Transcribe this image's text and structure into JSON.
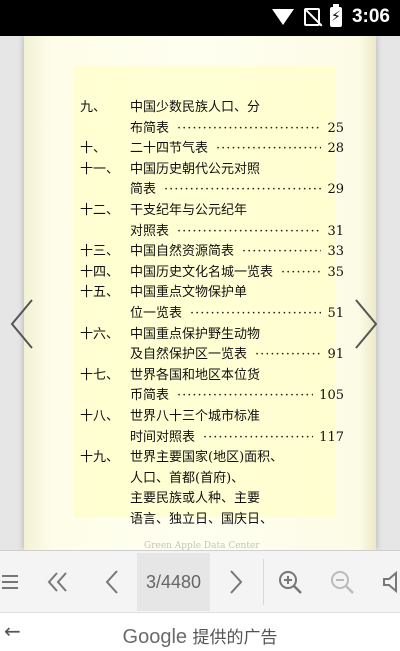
{
  "status_bar": {
    "time": "3:06"
  },
  "toc": [
    {
      "num": "九、",
      "title": "中国少数民族人口、分",
      "page": ""
    },
    {
      "num": "",
      "title": "布简表",
      "page": "25"
    },
    {
      "num": "十、",
      "title": "二十四节气表",
      "page": "28"
    },
    {
      "num": "十一、",
      "title": "中国历史朝代公元对照",
      "page": ""
    },
    {
      "num": "",
      "title": "简表",
      "page": "29"
    },
    {
      "num": "十二、",
      "title": "干支纪年与公元纪年",
      "page": ""
    },
    {
      "num": "",
      "title": "对照表",
      "page": "31"
    },
    {
      "num": "十三、",
      "title": "中国自然资源简表",
      "page": "33"
    },
    {
      "num": "十四、",
      "title": "中国历史文化名城一览表",
      "page": "35"
    },
    {
      "num": "十五、",
      "title": "中国重点文物保护单",
      "page": ""
    },
    {
      "num": "",
      "title": "位一览表",
      "page": "51"
    },
    {
      "num": "十六、",
      "title": "中国重点保护野生动物",
      "page": ""
    },
    {
      "num": "",
      "title": "及自然保护区一览表",
      "page": "91"
    },
    {
      "num": "十七、",
      "title": "世界各国和地区本位货",
      "page": ""
    },
    {
      "num": "",
      "title": "币简表",
      "page": "105"
    },
    {
      "num": "十八、",
      "title": "世界八十三个城市标准",
      "page": ""
    },
    {
      "num": "",
      "title": "时间对照表",
      "page": "117"
    },
    {
      "num": "十九、",
      "title": "世界主要国家(地区)面积、",
      "page": ""
    },
    {
      "num": "",
      "title": "人口、首都(首府)、",
      "page": ""
    },
    {
      "num": "",
      "title": "主要民族或人种、主要",
      "page": ""
    },
    {
      "num": "",
      "title": "语言、独立日、国庆日、",
      "page": ""
    }
  ],
  "watermark": "Green Apple Data Center",
  "toolbar": {
    "page_indicator": "3/4480"
  },
  "ad_bar": {
    "back_glyph": "←",
    "brand": "Google",
    "text": "提供的广告"
  },
  "icons": {
    "prev_page": "chevron-left-icon",
    "next_page": "chevron-right-icon",
    "menu": "menu-icon",
    "first_page": "double-chevron-left-icon",
    "zoom_in": "zoom-in-icon",
    "zoom_out": "zoom-out-icon",
    "audio": "speaker-icon"
  }
}
